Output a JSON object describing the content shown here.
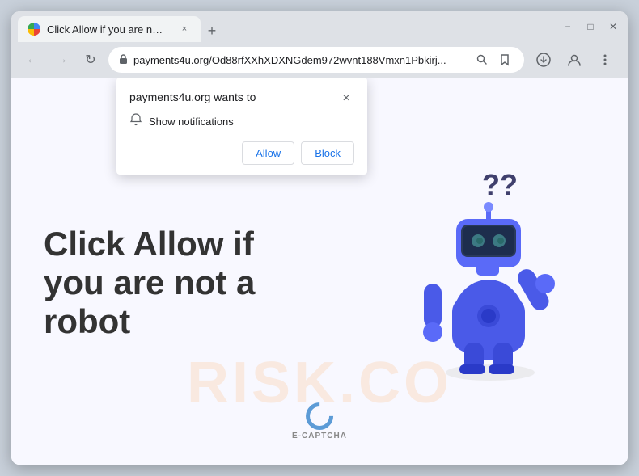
{
  "browser": {
    "tab": {
      "title": "Click Allow if you are not a robot",
      "close_label": "×"
    },
    "new_tab_label": "+",
    "window_controls": {
      "minimize": "−",
      "maximize": "□",
      "close": "✕"
    },
    "nav": {
      "back": "←",
      "forward": "→",
      "reload": "↻"
    },
    "url": "payments4u.org/Od88rfXXhXDXNGdem972wvnt188Vmxn1Pbkirj...",
    "url_icons": {
      "search": "🔍",
      "star": "☆",
      "profile": "👤",
      "menu": "⋮"
    }
  },
  "popup": {
    "title": "payments4u.org wants to",
    "notification_text": "Show notifications",
    "allow_label": "Allow",
    "block_label": "Block",
    "close_label": "×"
  },
  "page": {
    "main_text_line1": "Click Allow if",
    "main_text_line2": "you are not a",
    "main_text_line3": "robot",
    "watermark": "RISK.CO",
    "ecaptcha_label": "E-CAPTCHA",
    "question_marks": "??"
  }
}
